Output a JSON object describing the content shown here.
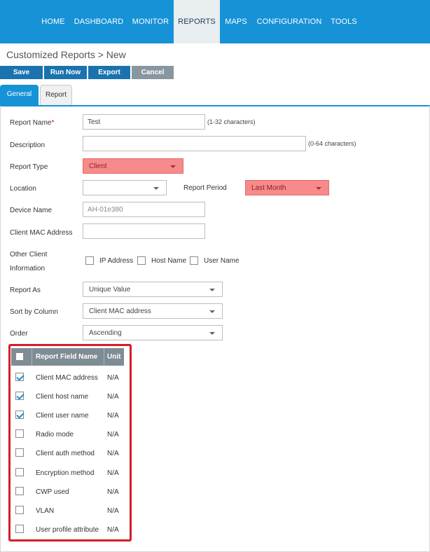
{
  "nav": {
    "items": [
      {
        "label": "HOME"
      },
      {
        "label": "DASHBOARD"
      },
      {
        "label": "MONITOR"
      },
      {
        "label": "REPORTS",
        "active": true
      },
      {
        "label": "MAPS"
      },
      {
        "label": "CONFIGURATION"
      },
      {
        "label": "TOOLS"
      }
    ]
  },
  "breadcrumb": "Customized Reports > New",
  "toolbar": {
    "save": "Save",
    "run_now": "Run Now",
    "export": "Export",
    "cancel": "Cancel"
  },
  "tabs": {
    "general": "General",
    "report": "Report"
  },
  "form": {
    "report_name": {
      "label": "Report Name",
      "required_mark": "*",
      "value": "Test",
      "hint": "(1-32 characters)"
    },
    "description": {
      "label": "Description",
      "value": "",
      "hint": "(0-64 characters)"
    },
    "report_type": {
      "label": "Report Type",
      "value": "Client"
    },
    "location": {
      "label": "Location",
      "value": ""
    },
    "report_period": {
      "label": "Report Period",
      "value": "Last Month"
    },
    "device_name": {
      "label": "Device Name",
      "placeholder": "AH-01e380"
    },
    "client_mac": {
      "label": "Client MAC Address",
      "value": ""
    },
    "other_client_info": {
      "label_line1": "Other Client",
      "label_line2": "Information",
      "options": [
        {
          "label": "IP Address",
          "checked": false
        },
        {
          "label": "Host Name",
          "checked": false
        },
        {
          "label": "User Name",
          "checked": false
        }
      ]
    },
    "report_as": {
      "label": "Report As",
      "value": "Unique Value"
    },
    "sort_by": {
      "label": "Sort by Column",
      "value": "Client MAC address"
    },
    "order": {
      "label": "Order",
      "value": "Ascending"
    }
  },
  "fields_table": {
    "headers": {
      "name": "Report Field Name",
      "unit": "Unit"
    },
    "rows": [
      {
        "name": "Client MAC address",
        "unit": "N/A",
        "checked": true
      },
      {
        "name": "Client host name",
        "unit": "N/A",
        "checked": true
      },
      {
        "name": "Client user name",
        "unit": "N/A",
        "checked": true
      },
      {
        "name": "Radio mode",
        "unit": "N/A",
        "checked": false
      },
      {
        "name": "Client auth method",
        "unit": "N/A",
        "checked": false
      },
      {
        "name": "Encryption method",
        "unit": "N/A",
        "checked": false
      },
      {
        "name": "CWP used",
        "unit": "N/A",
        "checked": false
      },
      {
        "name": "VLAN",
        "unit": "N/A",
        "checked": false
      },
      {
        "name": "User profile attribute",
        "unit": "N/A",
        "checked": false
      }
    ]
  },
  "colors": {
    "nav_bg": "#1692d6",
    "button_blue": "#1a73ae",
    "button_gray": "#87969f",
    "highlight_red": "#d21f28",
    "select_pink": "#f78a8a"
  }
}
